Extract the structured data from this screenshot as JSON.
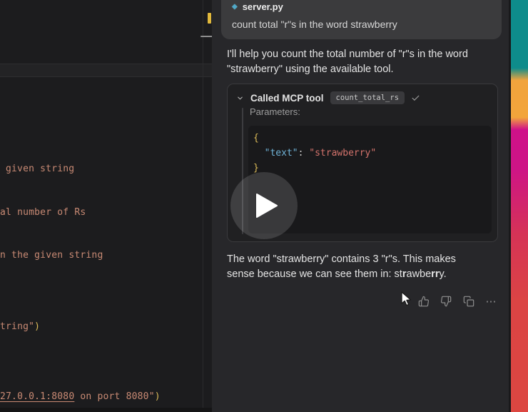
{
  "colors": {
    "salmon": "#c98a74",
    "yellow": "#dcbb58",
    "blue": "#6fb2d6",
    "red": "#d4736c",
    "punct": "#cfcfcf"
  },
  "editor": {
    "lines": [
      {
        "tokens": [
          {
            "t": "given string",
            "c": "salmon"
          }
        ]
      },
      {
        "tokens": [
          {
            "t": "al number of Rs",
            "c": "salmon"
          }
        ]
      },
      {
        "tokens": [
          {
            "t": "n the given string",
            "c": "salmon"
          }
        ]
      },
      {
        "tokens": [
          {
            "t": "tring\"",
            "c": "salmon"
          },
          {
            "t": ")",
            "c": "yellow"
          }
        ]
      },
      {
        "tokens": [
          {
            "t": "27.0.0.1:8080",
            "c": "salmon",
            "u": true
          },
          {
            "t": " on port 8080\"",
            "c": "salmon"
          },
          {
            "t": ")",
            "c": "yellow"
          }
        ]
      }
    ]
  },
  "chat": {
    "user_card": {
      "file_icon": "◆",
      "file_name": "server.py",
      "message": "count total \"r\"s in the word strawberry"
    },
    "intro_lines": [
      "I'll help you count the total number of \"r\"s in the word",
      "\"strawberry\" using the available tool."
    ],
    "tool_call": {
      "title": "Called MCP tool",
      "tool_name": "count_total_rs",
      "params_label": "Parameters:",
      "code_lines": [
        {
          "tokens": [
            {
              "t": "{",
              "c": "yellow"
            }
          ]
        },
        {
          "tokens": [
            {
              "t": "  ",
              "c": "punct"
            },
            {
              "t": "\"text\"",
              "c": "blue"
            },
            {
              "t": ":",
              "c": "punct"
            },
            {
              "t": " ",
              "c": "punct"
            },
            {
              "t": "\"strawberry\"",
              "c": "red"
            }
          ]
        },
        {
          "tokens": [
            {
              "t": "}",
              "c": "yellow"
            }
          ]
        }
      ]
    },
    "answer_line1": "The word \"strawberry\" contains 3 \"r\"s. This makes",
    "answer_line2_tokens": [
      {
        "t": "sense because we can see them in: st"
      },
      {
        "t": "r",
        "b": true
      },
      {
        "t": "awbe"
      },
      {
        "t": "rr",
        "b": true
      },
      {
        "t": "y."
      }
    ],
    "actions": {
      "more_glyph": "⋯"
    }
  }
}
